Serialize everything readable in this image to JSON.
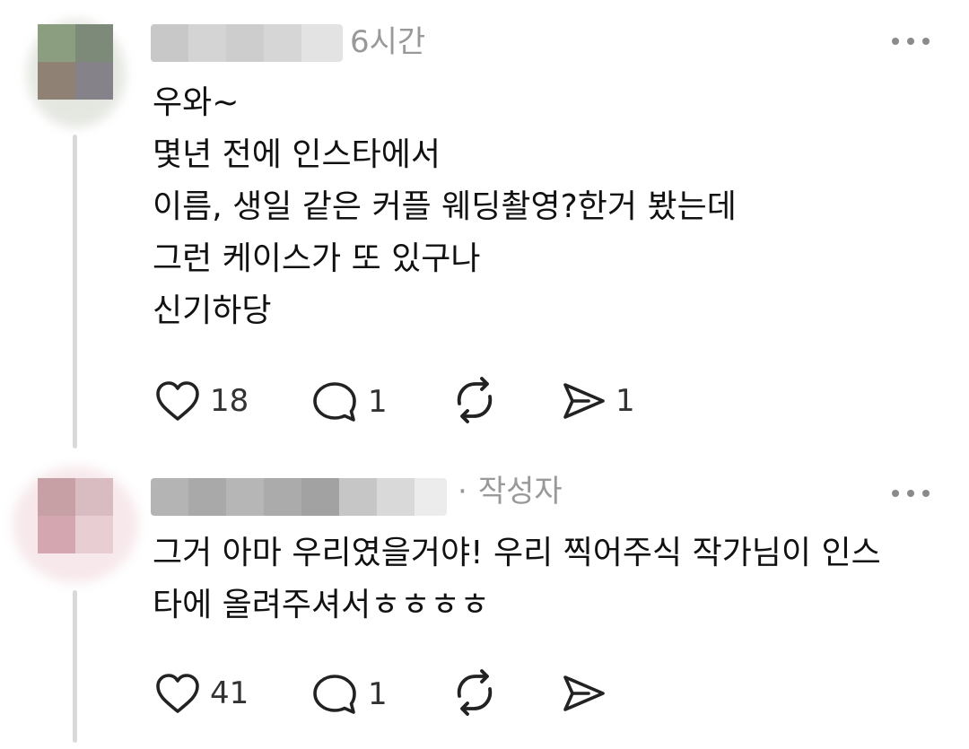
{
  "comments": [
    {
      "time": "6시간",
      "lines": [
        "우와~",
        "몇년 전에 인스타에서",
        "이름, 생일 같은 커플 웨딩촬영?한거 봤는데",
        "그런 케이스가 또 있구나",
        "신기하당"
      ],
      "actions": {
        "like_count": "18",
        "reply_count": "1",
        "share_count": "1"
      },
      "icons": {
        "like": "heart-icon",
        "reply": "comment-icon",
        "repost": "repost-icon",
        "share": "send-icon",
        "more": "more-icon"
      }
    },
    {
      "separator": "·",
      "author_badge": "작성자",
      "lines": [
        "그거 아마 우리였을거야! 우리 찍어주식 작가님이 인스",
        "타에 올려주셔서ㅎㅎㅎㅎ"
      ],
      "actions": {
        "like_count": "41",
        "reply_count": "1"
      },
      "icons": {
        "like": "heart-icon",
        "reply": "comment-icon",
        "repost": "repost-icon",
        "share": "send-icon",
        "more": "more-icon"
      }
    }
  ],
  "colors": {
    "text": "#111111",
    "meta": "#999999",
    "icon": "#222222",
    "thread_line": "#d9d9d9"
  }
}
